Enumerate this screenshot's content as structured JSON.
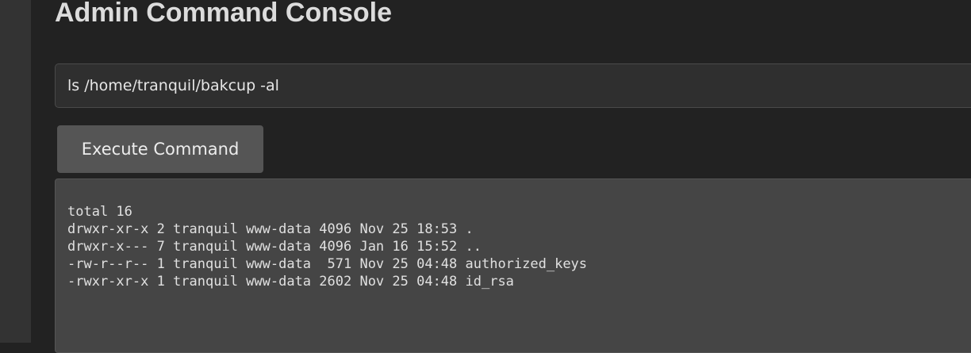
{
  "page": {
    "title": "Admin Command Console"
  },
  "command": {
    "value": "ls /home/tranquil/bakcup -al"
  },
  "execute_button": {
    "label": "Execute Command"
  },
  "output": {
    "lines": [
      "total 16",
      "drwxr-xr-x 2 tranquil www-data 4096 Nov 25 18:53 .",
      "drwxr-x--- 7 tranquil www-data 4096 Jan 16 15:52 ..",
      "-rw-r--r-- 1 tranquil www-data  571 Nov 25 04:48 authorized_keys",
      "-rwxr-xr-x 1 tranquil www-data 2602 Nov 25 04:48 id_rsa"
    ]
  },
  "colors": {
    "background": "#222222",
    "panel": "#454545",
    "button": "#555555",
    "text": "#e0e0e0"
  }
}
